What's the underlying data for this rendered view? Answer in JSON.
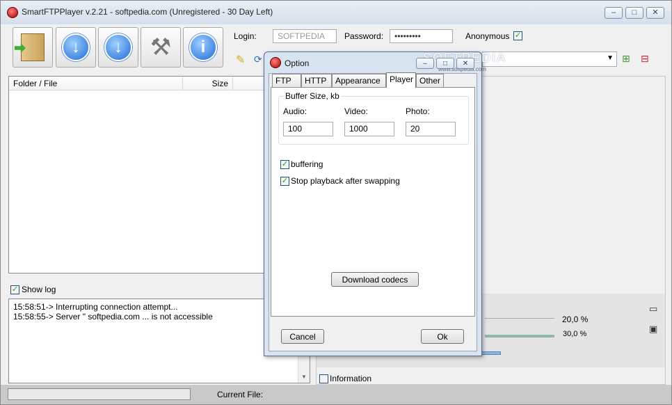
{
  "window": {
    "title": "SmartFTPPlayer v.2.21 - softpedia.com (Unregistered - 30 Day Left)",
    "minimize": "–",
    "maximize": "□",
    "close": "✕"
  },
  "toolbar": {
    "connect": "connect-icon",
    "download1": "download-icon",
    "download2": "download-icon",
    "settings": "tools-icon",
    "info": "info-icon",
    "login_label": "Login:",
    "login_value": "SOFTPEDIA",
    "password_label": "Password:",
    "password_value": "•••••••••",
    "anonymous_label": "Anonymous",
    "anonymous_checked": true
  },
  "file_list": {
    "headers": [
      "Folder / File",
      "Size"
    ]
  },
  "log": {
    "show_log_label": "Show log",
    "lines": [
      "15:58:51-> Interrupting connection attempt...",
      "15:58:55-> Server \" softpedia.com ... is not accessible"
    ]
  },
  "right_panel": {
    "percent1": "20,0 %",
    "percent2": "30,0 %",
    "information_label": "Information"
  },
  "status": {
    "current_file_label": "Current File:"
  },
  "dialog": {
    "title": "Option",
    "tabs": [
      "FTP",
      "HTTP",
      "Appearance",
      "Player",
      "Other"
    ],
    "active_tab": "Player",
    "buffer_group_label": "Buffer Size, kb",
    "audio_label": "Audio:",
    "video_label": "Video:",
    "photo_label": "Photo:",
    "audio_value": "100",
    "video_value": "1000",
    "photo_value": "20",
    "buffering_label": "buffering",
    "stop_playback_label": "Stop playback after swapping",
    "download_codecs_label": "Download codecs",
    "cancel_label": "Cancel",
    "ok_label": "Ok",
    "watermark": "SOFTPEDIA",
    "watermark_sub": "www.softpedia.com"
  }
}
